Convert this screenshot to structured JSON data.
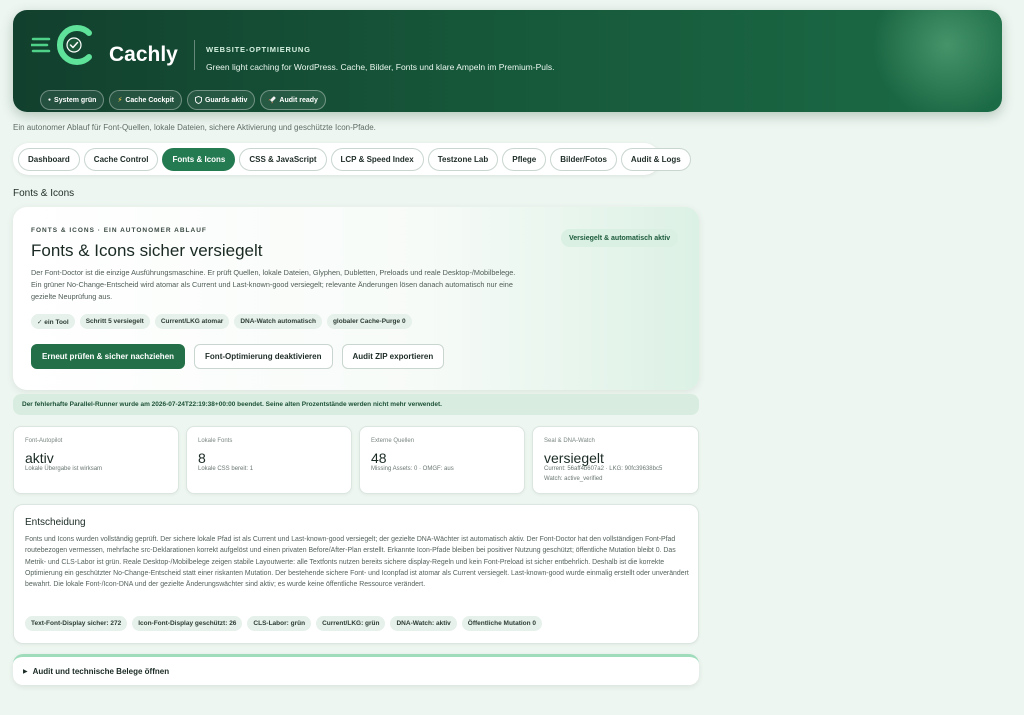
{
  "app": {
    "name": "Cachly",
    "kicker": "WEBSITE-OPTIMIERUNG",
    "tagline": "Green light caching for WordPress. Cache, Bilder, Fonts und klare Ampeln im Premium-Puls.",
    "chips": [
      {
        "icon": "dot-icon",
        "glyph": "●",
        "label": "System grün"
      },
      {
        "icon": "lightning-icon",
        "glyph": "⚡",
        "label": "Cache Cockpit"
      },
      {
        "icon": "shield-icon",
        "glyph": "🛡",
        "label": "Guards aktiv"
      },
      {
        "icon": "rocket-icon",
        "glyph": "🚀",
        "label": "Audit ready"
      }
    ]
  },
  "intro": "Ein autonomer Ablauf für Font-Quellen, lokale Dateien, sichere Aktivierung und geschützte Icon-Pfade.",
  "tabs": [
    {
      "label": "Dashboard"
    },
    {
      "label": "Cache Control"
    },
    {
      "label": "Fonts & Icons",
      "active": true
    },
    {
      "label": "CSS & JavaScript"
    },
    {
      "label": "LCP & Speed Index"
    },
    {
      "label": "Testzone Lab"
    },
    {
      "label": "Pflege"
    },
    {
      "label": "Bilder/Fotos"
    },
    {
      "label": "Audit & Logs"
    }
  ],
  "section_title": "Fonts & Icons",
  "card": {
    "kicker": "FONTS & ICONS · EIN AUTONOMER ABLAUF",
    "title": "Fonts & Icons sicher versiegelt",
    "description": "Der Font-Doctor ist die einzige Ausführungsmaschine. Er prüft Quellen, lokale Dateien, Glyphen, Dubletten, Preloads und reale Desktop-/Mobilbelege. Ein grüner No-Change-Entscheid wird atomar als Current und Last-known-good versiegelt; relevante Änderungen lösen danach automatisch nur eine gezielte Neuprüfung aus.",
    "badge": "Versiegelt & automatisch aktiv",
    "chips": [
      "✓ ein Tool",
      "Schritt 5 versiegelt",
      "Current/LKG atomar",
      "DNA-Watch automatisch",
      "globaler Cache-Purge 0"
    ],
    "actions": {
      "primary": "Erneut prüfen & sicher nachziehen",
      "deactivate": "Font-Optimierung deaktivieren",
      "export": "Audit ZIP exportieren"
    }
  },
  "notice": "Der fehlerhafte Parallel-Runner wurde am 2026-07-24T22:19:38+00:00 beendet. Seine alten Prozentstände werden nicht mehr verwendet.",
  "metrics": [
    {
      "label": "Font-Autopilot",
      "value": "aktiv",
      "sub": "Lokale Übergabe ist wirksam",
      "sub2": ""
    },
    {
      "label": "Lokale Fonts",
      "value": "8",
      "sub": "Lokale CSS bereit: 1",
      "sub2": ""
    },
    {
      "label": "Externe Quellen",
      "value": "48",
      "sub": "Missing Assets: 0 · OMGF: aus",
      "sub2": ""
    },
    {
      "label": "Seal & DNA-Watch",
      "value": "versiegelt",
      "sub": "Current: 56aff4b607a2 · LKG: 90fc39638bc5",
      "sub2": "Watch: active_verified"
    }
  ],
  "decision": {
    "title": "Entscheidung",
    "text": "Fonts und Icons wurden vollständig geprüft. Der sichere lokale Pfad ist als Current und Last-known-good versiegelt; der gezielte DNA-Wächter ist automatisch aktiv. Der Font-Doctor hat den vollständigen Font-Pfad routebezogen vermessen, mehrfache src-Deklarationen korrekt aufgelöst und einen privaten Before/After-Plan erstellt. Erkannte Icon-Pfade bleiben bei positiver Nutzung geschützt; öffentliche Mutation bleibt 0. Das Metrik- und CLS-Labor ist grün. Reale Desktop-/Mobilbelege zeigen stabile Layoutwerte: alle Textfonts nutzen bereits sichere display-Regeln und kein Font-Preload ist sicher entbehrlich. Deshalb ist die korrekte Optimierung ein geschützter No-Change-Entscheid statt einer riskanten Mutation. Der bestehende sichere Font- und Iconpfad ist atomar als Current versiegelt. Last-known-good wurde einmalig erstellt oder unverändert bewahrt. Die lokale Font-/Icon-DNA und der gezielte Änderungswächter sind aktiv; es wurde keine öffentliche Ressource verändert.",
    "chips": [
      "Text-Font-Display sicher: 272",
      "Icon-Font-Display geschützt: 26",
      "CLS-Labor: grün",
      "Current/LKG: grün",
      "DNA-Watch: aktiv",
      "Öffentliche Mutation 0"
    ]
  },
  "audit": {
    "arrow": "▶",
    "label": "Audit und technische Belege öffnen"
  },
  "colors": {
    "brand_dark": "#12402e",
    "brand": "#247a51",
    "accent_light": "#d9f0e2",
    "background": "#eef6f1"
  }
}
